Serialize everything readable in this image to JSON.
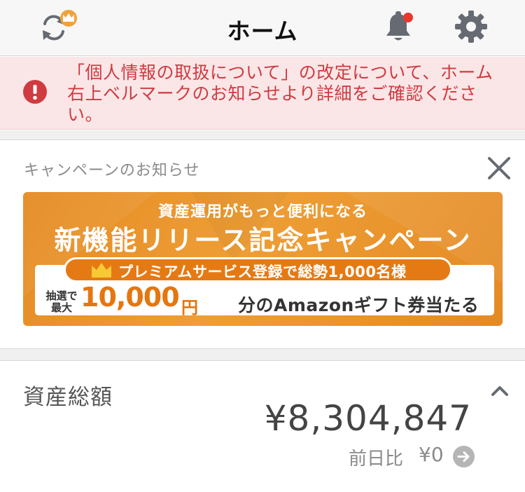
{
  "header": {
    "title": "ホーム"
  },
  "alert": {
    "message": "「個人情報の取扱について」の改定について、ホーム右上ベルマークのお知らせより詳細をご確認ください。"
  },
  "campaign": {
    "label": "キャンペーンのお知らせ",
    "banner": {
      "line1": "資産運用がもっと便利になる",
      "line2": "新機能リリース記念キャンペーン",
      "pill": "プレミアムサービス登録で総勢1,000名様",
      "small_top": "抽選で",
      "small_bottom": "最大",
      "amount": "10,000",
      "yen": "円",
      "rest": "分のAmazonギフト券当たる"
    }
  },
  "assets": {
    "label": "資産総額",
    "total": "¥8,304,847",
    "diff_label": "前日比",
    "diff_value": "¥0"
  },
  "colors": {
    "accent_orange": "#e58a22",
    "alert_red": "#cf3b41",
    "alert_bg": "#fbe6e7",
    "icon_gray": "#666b73"
  },
  "icons": [
    "sync-icon",
    "crown-badge-icon",
    "bell-icon",
    "gear-icon",
    "alert-icon",
    "close-icon",
    "crown-icon",
    "chevron-up-icon",
    "arrow-right-circle-icon"
  ]
}
